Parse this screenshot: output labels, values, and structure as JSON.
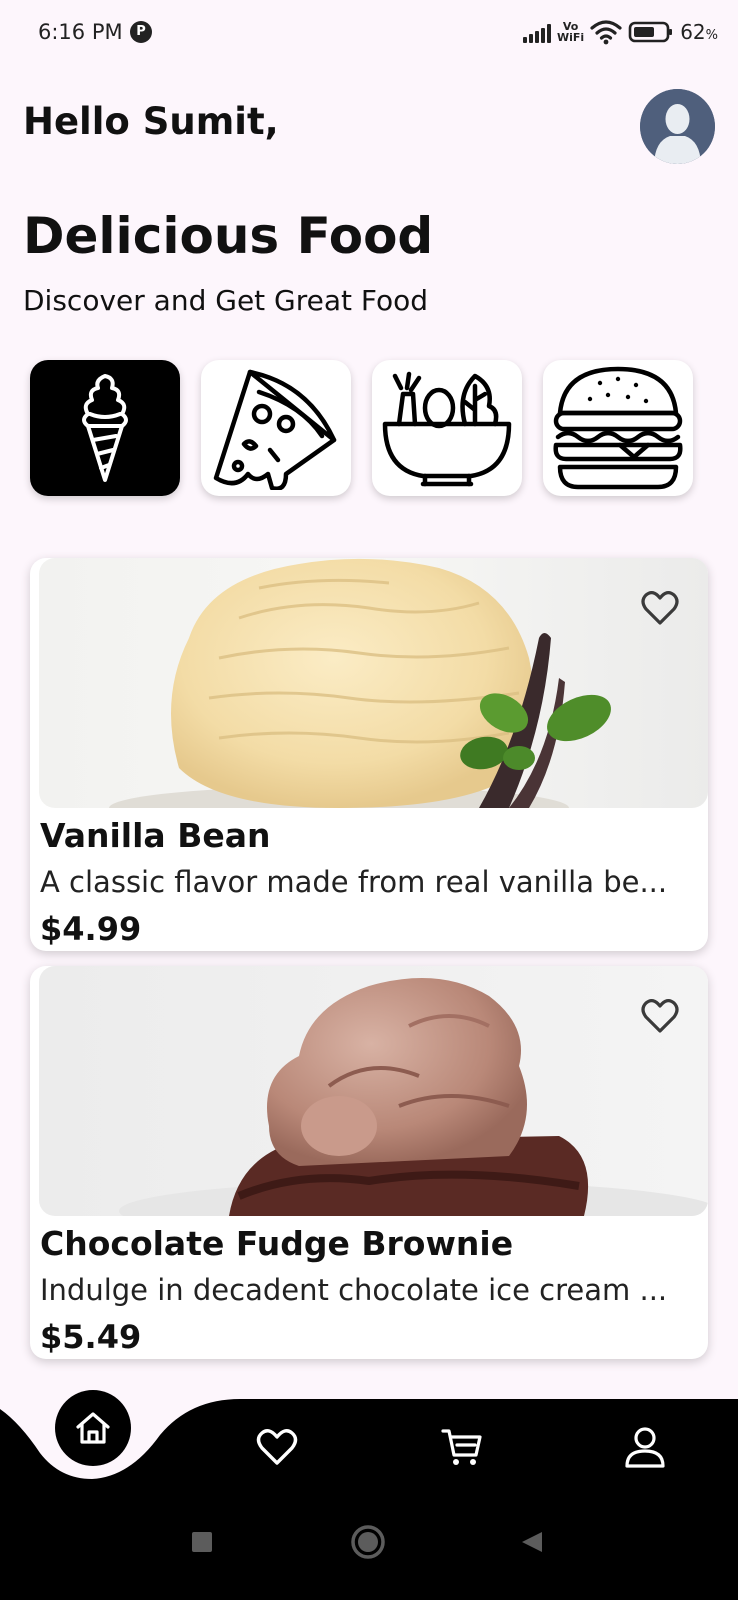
{
  "status_bar": {
    "time": "6:16 PM",
    "time_badge": "P",
    "network_label_top": "Vo",
    "network_label_bottom": "WiFi",
    "battery_percent": "62",
    "battery_unit": "%"
  },
  "header": {
    "greeting": "Hello Sumit,",
    "avatar_icon": "user-avatar"
  },
  "hero": {
    "title": "Delicious Food",
    "subtitle": "Discover and Get Great Food"
  },
  "categories": [
    {
      "icon": "ice-cream-icon",
      "selected": true
    },
    {
      "icon": "pizza-icon",
      "selected": false
    },
    {
      "icon": "salad-bowl-icon",
      "selected": false
    },
    {
      "icon": "burger-icon",
      "selected": false
    }
  ],
  "products": [
    {
      "name": "Vanilla Bean",
      "description": "A classic flavor made from real vanilla be...",
      "price": "$4.99",
      "favorite_icon": "heart-outline-icon"
    },
    {
      "name": "Chocolate Fudge Brownie",
      "description": "Indulge in decadent chocolate ice cream ...",
      "price": "$5.49",
      "favorite_icon": "heart-outline-icon"
    }
  ],
  "bottom_nav": {
    "items": [
      "home-icon",
      "heart-icon",
      "cart-icon",
      "profile-icon"
    ],
    "active": "home-icon"
  },
  "system_nav": [
    "square-icon",
    "circle-icon",
    "back-triangle-icon"
  ],
  "colors": {
    "background": "#fdf6fc",
    "primary": "#000000",
    "card": "#ffffff"
  }
}
